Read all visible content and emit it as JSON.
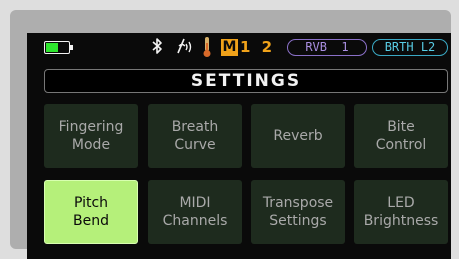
{
  "status_bar": {
    "battery_level": 0.55,
    "battery_color": "#2ee62e",
    "bluetooth_icon": "bluetooth-icon",
    "breath_icon": "breath-sensor-icon",
    "temperature_icon": "thermometer-icon",
    "mode_letter": "M",
    "mode_digits": "1 2",
    "mode_color": "#f0a21a",
    "reverb_pill": "RVB  1",
    "reverb_color": "#a98ee0",
    "breath_pill": "BRTH L2",
    "breath_color": "#58cbe3"
  },
  "title": "SETTINGS",
  "menu": {
    "items": [
      {
        "label": "Fingering\nMode",
        "selected": false
      },
      {
        "label": "Breath\nCurve",
        "selected": false
      },
      {
        "label": "Reverb",
        "selected": false
      },
      {
        "label": "Bite\nControl",
        "selected": false
      },
      {
        "label": "Pitch\nBend",
        "selected": true
      },
      {
        "label": "MIDI\nChannels",
        "selected": false
      },
      {
        "label": "Transpose\nSettings",
        "selected": false
      },
      {
        "label": "LED\nBrightness",
        "selected": false
      }
    ],
    "selected_color": "#b5f07a",
    "tile_color": "#1e2b1e"
  }
}
